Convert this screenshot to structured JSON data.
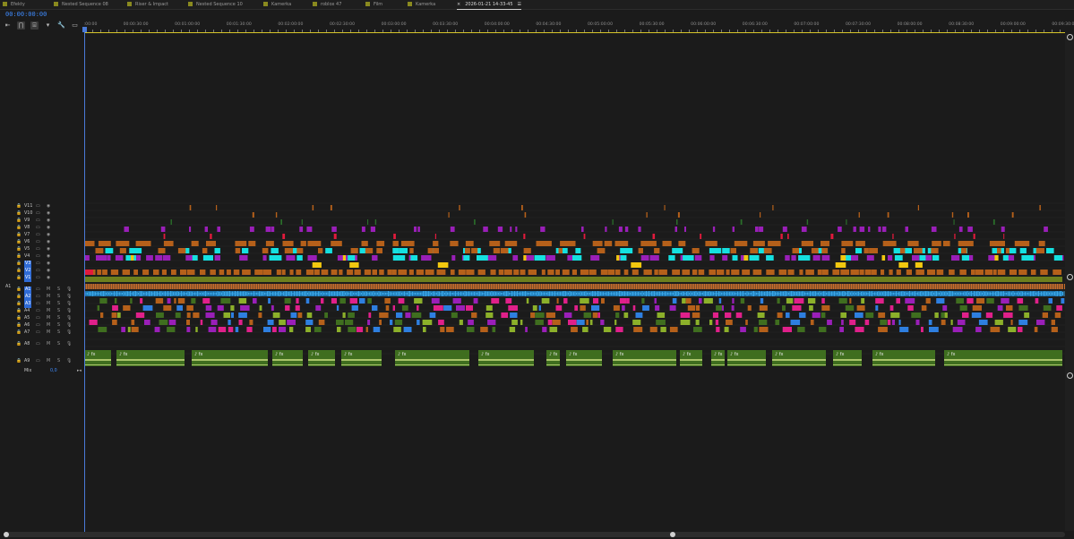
{
  "tabs": [
    {
      "label": "Efekty",
      "active": false
    },
    {
      "label": "Nested Sequence 08",
      "active": false
    },
    {
      "label": "Riser & Impact",
      "active": false
    },
    {
      "label": "Nested Sequence 10",
      "active": false
    },
    {
      "label": "Kamerka",
      "active": false
    },
    {
      "label": "roblox 47",
      "active": false
    },
    {
      "label": "Film",
      "active": false
    },
    {
      "label": "Kamerka",
      "active": false
    },
    {
      "label": "2026-01-21 14-33-45",
      "active": true
    }
  ],
  "active_tab_marker": "×",
  "active_tab_menu": "☰",
  "timecode": "00:00:00:00",
  "tools": [
    {
      "icon": "insert-icon",
      "glyph": "⇤"
    },
    {
      "icon": "snap-icon",
      "glyph": "⋂"
    },
    {
      "icon": "linked-selection-icon",
      "glyph": "⌸"
    },
    {
      "icon": "marker-icon",
      "glyph": "▾"
    },
    {
      "icon": "wrench-icon",
      "glyph": "🔧"
    },
    {
      "icon": "captions-icon",
      "glyph": "▭"
    }
  ],
  "ruler_ticks": [
    ":00:00",
    "00:00:30:00",
    "00:01:00:00",
    "00:01:30:00",
    "00:02:00:00",
    "00:02:30:00",
    "00:03:00:00",
    "00:03:30:00",
    "00:04:00:00",
    "00:04:30:00",
    "00:05:00:00",
    "00:05:30:00",
    "00:06:00:00",
    "00:06:30:00",
    "00:07:00:00",
    "00:07:30:00",
    "00:08:00:00",
    "00:08:30:00",
    "00:09:00:00",
    "00:09:30:00"
  ],
  "video_tracks": [
    {
      "name": "V11",
      "targeted": false
    },
    {
      "name": "V10",
      "targeted": false
    },
    {
      "name": "V9",
      "targeted": false
    },
    {
      "name": "V8",
      "targeted": false
    },
    {
      "name": "V7",
      "targeted": false
    },
    {
      "name": "V6",
      "targeted": false
    },
    {
      "name": "V5",
      "targeted": false
    },
    {
      "name": "V4",
      "targeted": false
    },
    {
      "name": "V3",
      "targeted": true
    },
    {
      "name": "V2",
      "targeted": true
    },
    {
      "name": "V1",
      "targeted": true
    }
  ],
  "audio_source_label": "A1",
  "audio_tracks": [
    {
      "name": "A1",
      "targeted": true
    },
    {
      "name": "A2",
      "targeted": true
    },
    {
      "name": "A3",
      "targeted": true
    },
    {
      "name": "A4",
      "targeted": false
    },
    {
      "name": "A5",
      "targeted": false
    },
    {
      "name": "A6",
      "targeted": false
    },
    {
      "name": "A7",
      "targeted": false
    },
    {
      "name": "A8",
      "targeted": false
    },
    {
      "name": "A9",
      "targeted": false
    }
  ],
  "track_glyphs": {
    "lock": "🔒",
    "video_sync": "▭",
    "eye": "◉",
    "mute": "M",
    "solo": "S",
    "mic": "🎙"
  },
  "mix": {
    "label": "Mix",
    "value": "0,0",
    "end_glyph": "▸◂"
  },
  "clip_colors": {
    "purple": "#9a1fb8",
    "orange": "#b5601a",
    "cyan": "#15e0e0",
    "red": "#e11a3c",
    "yellow": "#f2c80f",
    "olive": "#6d7f1e",
    "audio_green": "#3f6e1f",
    "audio_blue": "#3aa7e8",
    "magenta": "#e0208a",
    "dark_green": "#2a6e2a"
  }
}
